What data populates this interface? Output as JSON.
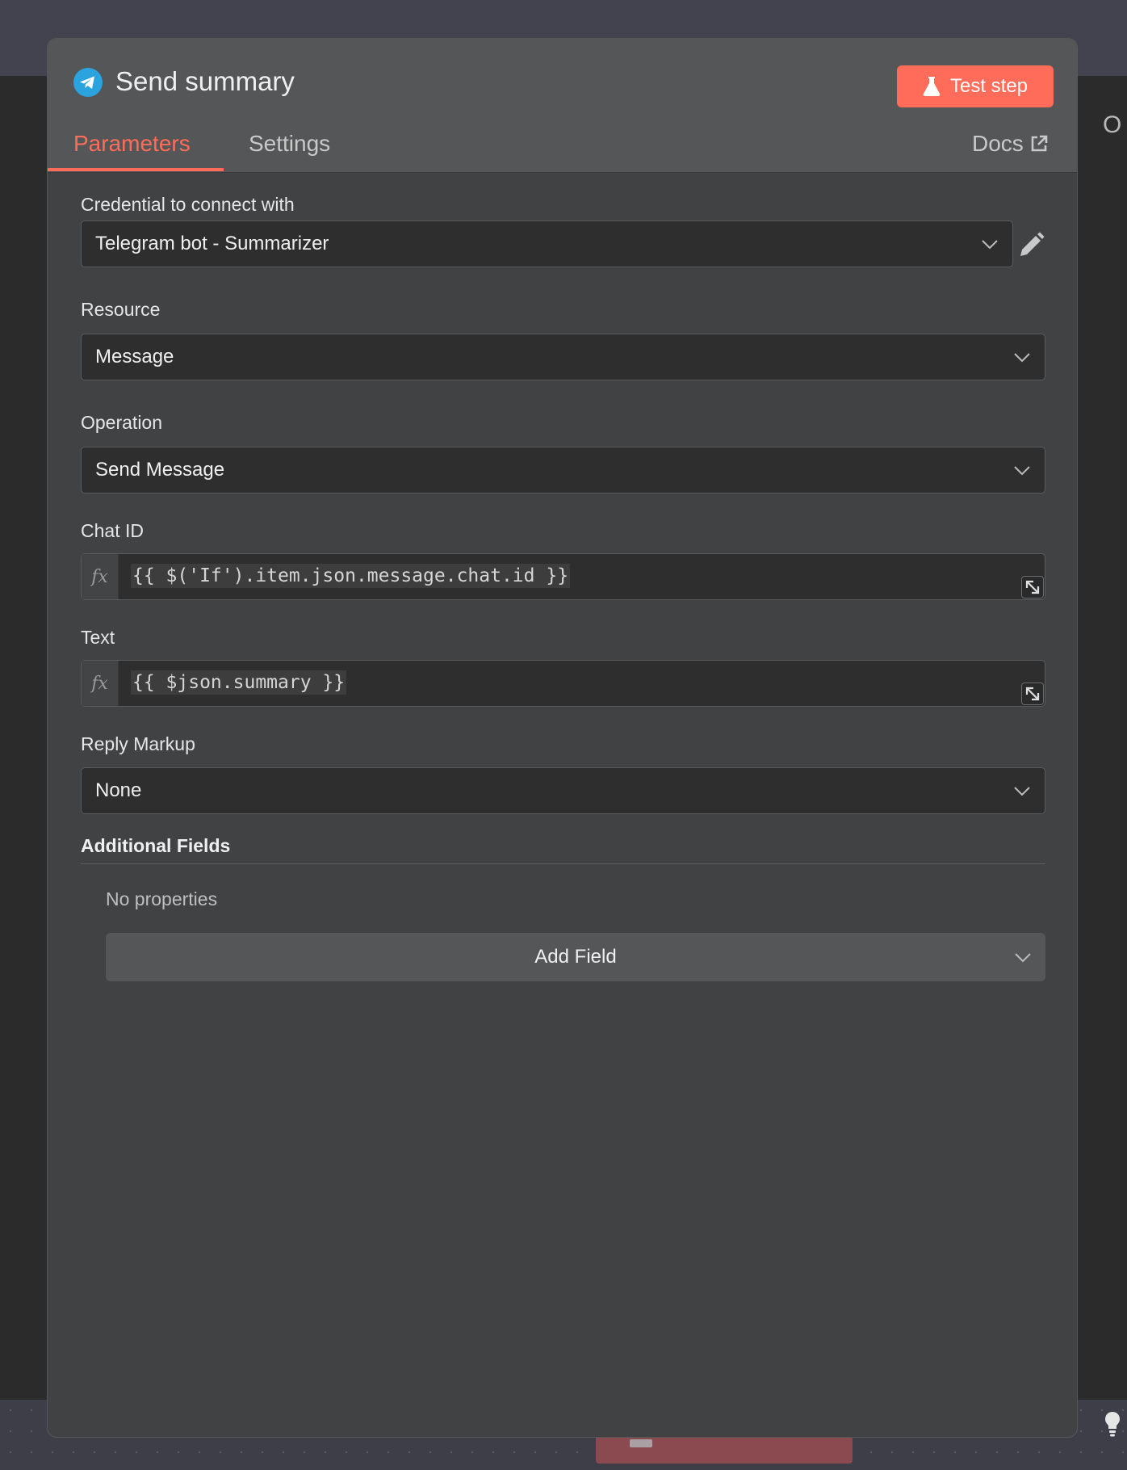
{
  "node": {
    "title": "Send summary",
    "icon": "telegram-icon",
    "test_button_label": "Test step"
  },
  "tabs": [
    {
      "label": "Parameters",
      "active": true
    },
    {
      "label": "Settings",
      "active": false
    }
  ],
  "docs_label": "Docs",
  "fields": {
    "credential": {
      "label": "Credential to connect with",
      "value": "Telegram bot - Summarizer"
    },
    "resource": {
      "label": "Resource",
      "value": "Message"
    },
    "operation": {
      "label": "Operation",
      "value": "Send Message"
    },
    "chat_id": {
      "label": "Chat ID",
      "expression": "{{ $('If').item.json.message.chat.id }}"
    },
    "text": {
      "label": "Text",
      "expression": "{{ $json.summary }}"
    },
    "reply_markup": {
      "label": "Reply Markup",
      "value": "None"
    }
  },
  "additional_fields": {
    "title": "Additional Fields",
    "empty_text": "No properties",
    "add_button_label": "Add Field"
  },
  "background": {
    "edge_letter": "O"
  },
  "colors": {
    "accent": "#ff6d5a",
    "telegram": "#2aa3df"
  }
}
